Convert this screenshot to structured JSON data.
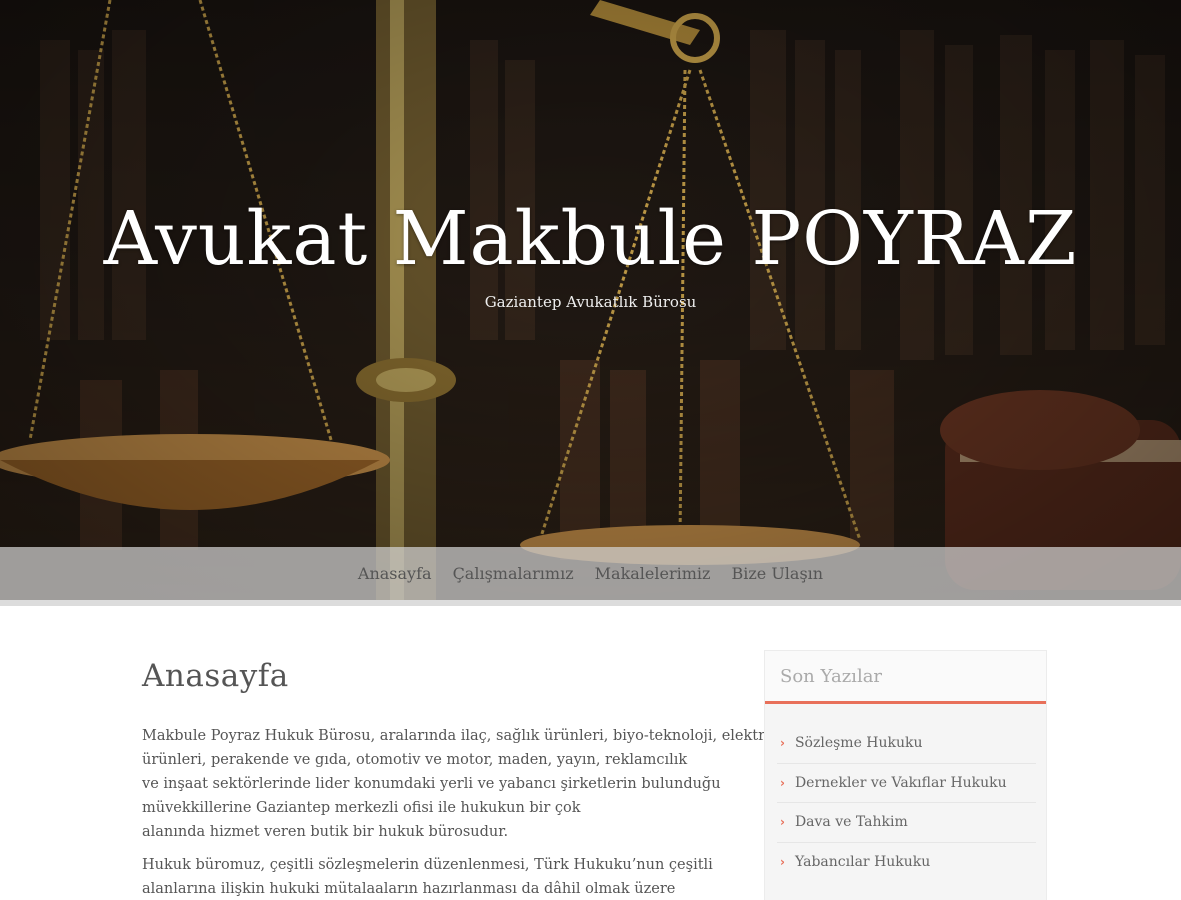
{
  "site": {
    "title": "Avukat Makbule POYRAZ",
    "description": "Gaziantep Avukatlık Bürosu"
  },
  "nav": {
    "items": [
      "Anasayfa",
      "Çalışmalarımız",
      "Makalelerimiz",
      "Bize Ulaşın"
    ]
  },
  "page": {
    "title": "Anasayfa",
    "paragraph1_lines": [
      "Makbule Poyraz Hukuk Bürosu, aralarında ilaç, sağlık ürünleri, biyo-teknoloji, elektrik",
      "ürünleri, perakende ve gıda, otomotiv ve motor, maden, yayın, reklamcılık",
      "ve inşaat sektörlerinde lider konumdaki yerli ve yabancı şirketlerin bulunduğu",
      "müvekkillerine Gaziantep merkezli ofisi ile hukukun bir çok",
      "alanında hizmet veren butik bir hukuk bürosudur."
    ],
    "paragraph2_lines": [
      "Hukuk büromuz, çeşitli sözleşmelerin düzenlenmesi, Türk Hukuku’nun çeşitli",
      "alanlarına ilişkin hukuki mütalaaların hazırlanması da dâhil olmak üzere"
    ]
  },
  "sidebar": {
    "widget_title": "Son Yazılar",
    "posts": [
      "Sözleşme Hukuku",
      "Dernekler ve Vakıflar Hukuku",
      "Dava ve Tahkim",
      "Yabancılar Hukuku"
    ]
  },
  "colors": {
    "accent": "#e8705a",
    "text": "#555555",
    "nav_bg": "#d2d2d2"
  },
  "icons": {
    "list_bullet": "chevron-right-icon"
  }
}
